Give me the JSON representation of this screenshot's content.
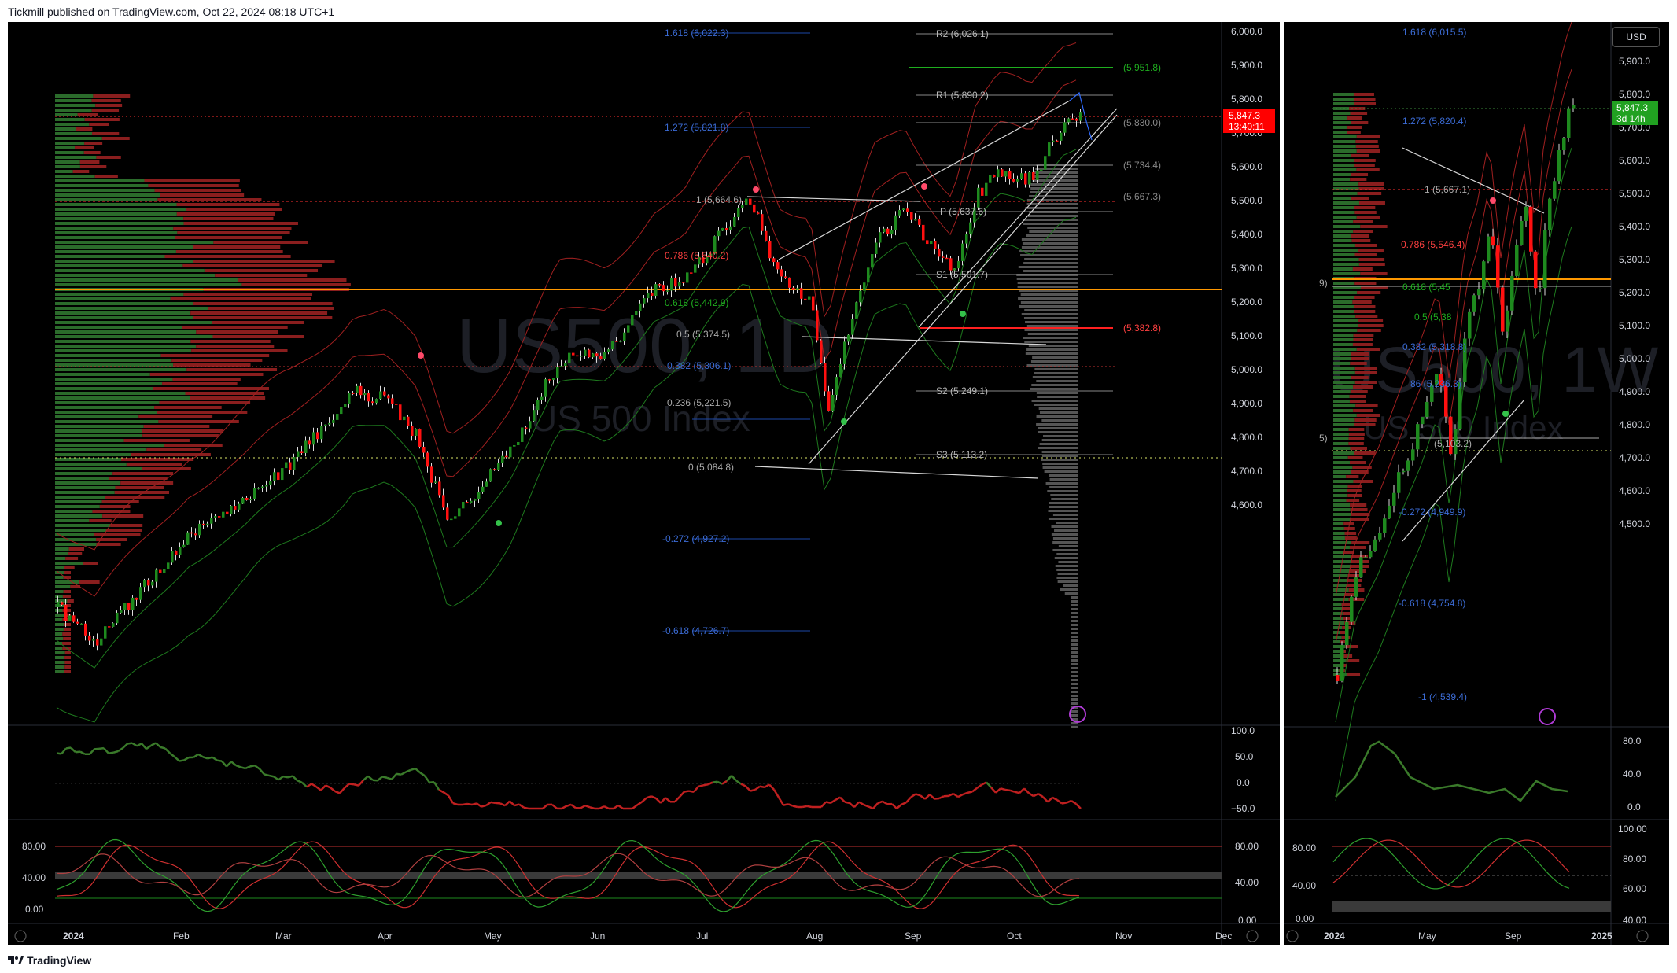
{
  "header": {
    "attribution": "Tickmill published on TradingView.com, Oct 22, 2024 08:18 UTC+1"
  },
  "footer": {
    "brand": "TradingView"
  },
  "colors": {
    "up": "#1e8a1e",
    "down": "#ff1010",
    "background": "#000000",
    "price_label": "#ff0000",
    "price_label_w": "#21a121",
    "orange_line": "#ff9800"
  },
  "left": {
    "watermark_symbol": "US500, 1D",
    "watermark_name": "US 500 Index",
    "price_label": "5,847.3",
    "countdown": "13:40:11",
    "price_axis": [
      "6,000.0",
      "5,900.0",
      "5,800.0",
      "5,700.0",
      "5,600.0",
      "5,500.0",
      "5,400.0",
      "5,300.0",
      "5,200.0",
      "5,100.0",
      "5,000.0",
      "4,900.0",
      "4,800.0",
      "4,700.0",
      "4,600.0"
    ],
    "time_axis": [
      "2024",
      "Feb",
      "Mar",
      "Apr",
      "May",
      "Jun",
      "Jul",
      "Aug",
      "Sep",
      "Oct",
      "Nov",
      "Dec"
    ],
    "fib_labels": [
      "1.618 (6,022.3)",
      "1.272 (5,821.8)",
      "1 (5,664.6)",
      "0.786 (5,540.2)",
      "0.618 (5,442.9)",
      "0.5 (5,374.5)",
      "0.382 (5,306.1)",
      "0.236 (5,221.5)",
      "0 (5,084.8)",
      "-0.272 (4,927.2)",
      "-0.618 (4,726.7)"
    ],
    "pivot_labels": [
      "R2 (6,026.1)",
      "R1 (5,890.2)",
      "P (5,637.6)",
      "S1 (5,501.7)",
      "S2 (5,249.1)",
      "S3 (5,113.2)"
    ],
    "level_labels": [
      "(5,951.8)",
      "(5,830.0)",
      "(5,734.4)",
      "(5,667.3)",
      "(5,382.8)"
    ],
    "osc1_axis": [
      "100.0",
      "50.0",
      "0.0",
      "−50.0"
    ],
    "osc2_axis_left": [
      "80.00",
      "40.00",
      "0.00"
    ],
    "osc2_axis_right": [
      "80.00",
      "40.00",
      "0.00"
    ]
  },
  "right": {
    "currency": "USD",
    "watermark_symbol": "US500, 1W",
    "watermark_name": "US 500 Index",
    "price_label": "5,847.3",
    "countdown": "3d 14h",
    "price_axis": [
      "5,900.0",
      "5,800.0",
      "5,700.0",
      "5,600.0",
      "5,500.0",
      "5,400.0",
      "5,300.0",
      "5,200.0",
      "5,100.0",
      "5,000.0",
      "4,900.0",
      "4,800.0",
      "4,700.0",
      "4,600.0",
      "4,500.0"
    ],
    "time_axis": [
      "2024",
      "May",
      "Sep",
      "2025"
    ],
    "fib_labels": [
      "1.618 (6,015.5)",
      "1.272 (5,820.4)",
      "1 (5,667.1)",
      "0.786 (5,546.4)",
      "0.618 (5,45",
      "0.5 (5,38",
      "0.382 (5,318.8)",
      "86 (5,236.3)",
      "(5,103.2)",
      "-0.272 (4,949.9)",
      "-0.618 (4,754.8)",
      "-1 (4,539.4)"
    ],
    "left_fragments": [
      "9)",
      "5)"
    ],
    "osc1_axis": [
      "80.0",
      "40.0",
      "0.0"
    ],
    "osc2_axis_left": [
      "80.00",
      "40.00",
      "0.00"
    ],
    "osc2_axis_right": [
      "100.00",
      "80.00",
      "60.00",
      "40.00"
    ]
  }
}
